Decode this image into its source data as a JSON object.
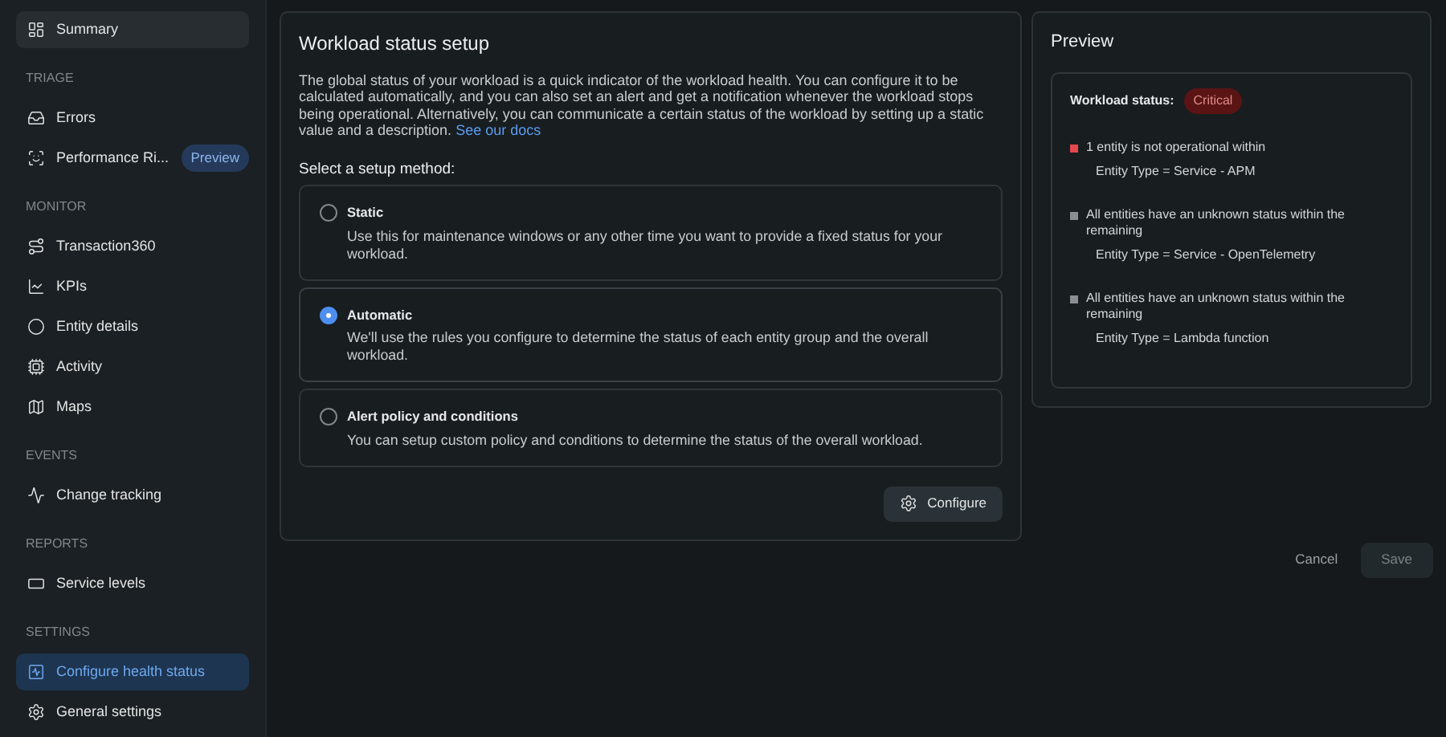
{
  "sidebar": {
    "groups": [
      {
        "items": [
          {
            "label": "Summary",
            "selected": false,
            "hovered": true
          }
        ]
      },
      {
        "heading": "TRIAGE",
        "items": [
          {
            "label": "Errors",
            "selected": false,
            "hovered": false
          },
          {
            "label": "Performance Ri...",
            "badge": "Preview",
            "selected": false,
            "hovered": false
          }
        ]
      },
      {
        "heading": "MONITOR",
        "items": [
          {
            "label": "Transaction360",
            "selected": false,
            "hovered": false
          },
          {
            "label": "KPIs",
            "selected": false,
            "hovered": false
          },
          {
            "label": "Entity details",
            "selected": false,
            "hovered": false
          },
          {
            "label": "Activity",
            "selected": false,
            "hovered": false
          },
          {
            "label": "Maps",
            "selected": false,
            "hovered": false
          }
        ]
      },
      {
        "heading": "EVENTS",
        "items": [
          {
            "label": "Change tracking",
            "selected": false,
            "hovered": false
          }
        ]
      },
      {
        "heading": "REPORTS",
        "items": [
          {
            "label": "Service levels",
            "selected": false,
            "hovered": false
          }
        ]
      },
      {
        "heading": "SETTINGS",
        "items": [
          {
            "label": "Configure health status",
            "selected": true,
            "hovered": false
          },
          {
            "label": "General settings",
            "selected": false,
            "hovered": false
          }
        ]
      }
    ]
  },
  "setup": {
    "title": "Workload status setup",
    "description": "The global status of your workload is a quick indicator of the workload health. You can configure it to be calculated automatically, and you can also set an alert and get a notification whenever the workload stops being operational. Alternatively, you can communicate a certain status of the workload by setting up a static value and a description.",
    "docs_link": "See our docs",
    "method_heading": "Select a setup method:",
    "methods": [
      {
        "title": "Static",
        "description": "Use this for maintenance windows or any other time you want to provide a fixed status for your workload.",
        "selected": false
      },
      {
        "title": "Automatic",
        "description": "We'll use the rules you configure to determine the status of each entity group and the overall workload.",
        "selected": true
      },
      {
        "title": "Alert policy and conditions",
        "description": "You can setup custom policy and conditions to determine the status of the overall workload.",
        "selected": false
      }
    ],
    "configure_button": "Configure"
  },
  "preview": {
    "title": "Preview",
    "status_label": "Workload status:",
    "status": "Critical",
    "rules": [
      {
        "text": "1 entity is not operational within",
        "detail": "Entity Type = Service - APM",
        "color": "#e5484d"
      },
      {
        "text": "All entities have an unknown status within the remaining",
        "detail": "Entity Type = Service - OpenTelemetry",
        "color": "#8b8f93"
      },
      {
        "text": "All entities have an unknown status within the remaining",
        "detail": "Entity Type = Lambda function",
        "color": "#8b8f93"
      }
    ]
  },
  "footer": {
    "cancel": "Cancel",
    "save": "Save",
    "save_disabled": true
  }
}
